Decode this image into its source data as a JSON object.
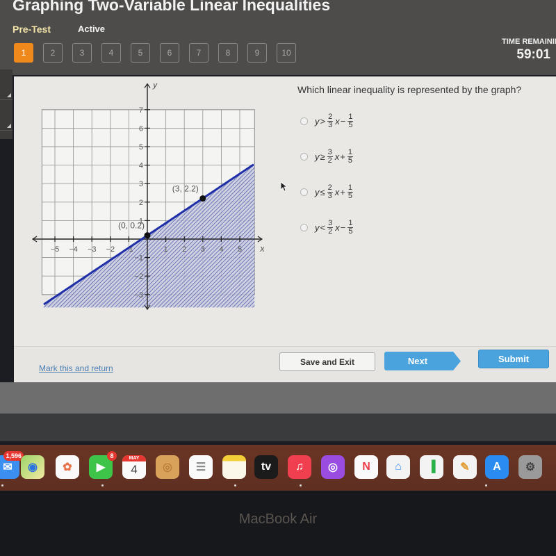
{
  "app": {
    "title": "Graphing Two-Variable Linear Inequalities",
    "tabs": [
      {
        "label": "Pre-Test",
        "selected": true
      },
      {
        "label": "Active",
        "selected": false
      }
    ]
  },
  "question_nav": {
    "items": [
      "1",
      "2",
      "3",
      "4",
      "5",
      "6",
      "7",
      "8",
      "9",
      "10"
    ],
    "current": "1",
    "current_color": "#f0891c"
  },
  "timer": {
    "label": "TIME REMAINING",
    "value": "59:01"
  },
  "question": {
    "prompt": "Which linear inequality is represented by the graph?",
    "options": [
      {
        "y": "y",
        "op": ">",
        "num": "2",
        "den": "3",
        "x": "x",
        "sign": "−",
        "cnum": "1",
        "cden": "5"
      },
      {
        "y": "y",
        "op": "≥",
        "num": "3",
        "den": "2",
        "x": "x",
        "sign": "+",
        "cnum": "1",
        "cden": "5"
      },
      {
        "y": "y",
        "op": "≤",
        "num": "2",
        "den": "3",
        "x": "x",
        "sign": "+",
        "cnum": "1",
        "cden": "5"
      },
      {
        "y": "y",
        "op": "<",
        "num": "3",
        "den": "2",
        "x": "x",
        "sign": "−",
        "cnum": "1",
        "cden": "5"
      }
    ]
  },
  "graph": {
    "x_label": "x",
    "y_label": "y",
    "x_ticks": [
      "−5",
      "−4",
      "−3",
      "−2",
      "−1",
      "1",
      "2",
      "3",
      "4",
      "5"
    ],
    "y_ticks": [
      "7",
      "6",
      "5",
      "4",
      "3",
      "2",
      "1",
      "−1",
      "−2",
      "−3"
    ],
    "x_range": [
      -5,
      5
    ],
    "y_range": [
      -3,
      7
    ],
    "points": [
      {
        "label": "(0, 0.2)",
        "x": 0,
        "y": 0.2
      },
      {
        "label": "(3, 2.2)",
        "x": 3,
        "y": 2.2
      }
    ],
    "line": {
      "slope": 0.6667,
      "intercept": 0.2,
      "style": "solid",
      "color": "#1f2fa8"
    },
    "shading": "below",
    "shade_color": "#3b4a9e"
  },
  "footer": {
    "mark_link": "Mark this and return",
    "save_label": "Save and Exit",
    "next_label": "Next",
    "submit_label": "Submit"
  },
  "dock": {
    "items": [
      {
        "name": "mail",
        "badge": "1,596"
      },
      {
        "name": "maps"
      },
      {
        "name": "photos"
      },
      {
        "name": "facetime",
        "badge": "8"
      },
      {
        "name": "calendar",
        "month": "MAY",
        "day": "4"
      },
      {
        "name": "contacts"
      },
      {
        "name": "reminders"
      },
      {
        "name": "notes"
      },
      {
        "name": "apple-tv",
        "label": "tv"
      },
      {
        "name": "music"
      },
      {
        "name": "podcasts"
      },
      {
        "name": "news"
      },
      {
        "name": "keynote"
      },
      {
        "name": "numbers"
      },
      {
        "name": "pages"
      },
      {
        "name": "app-store"
      },
      {
        "name": "system-preferences"
      }
    ]
  },
  "device": {
    "label": "MacBook Air"
  }
}
